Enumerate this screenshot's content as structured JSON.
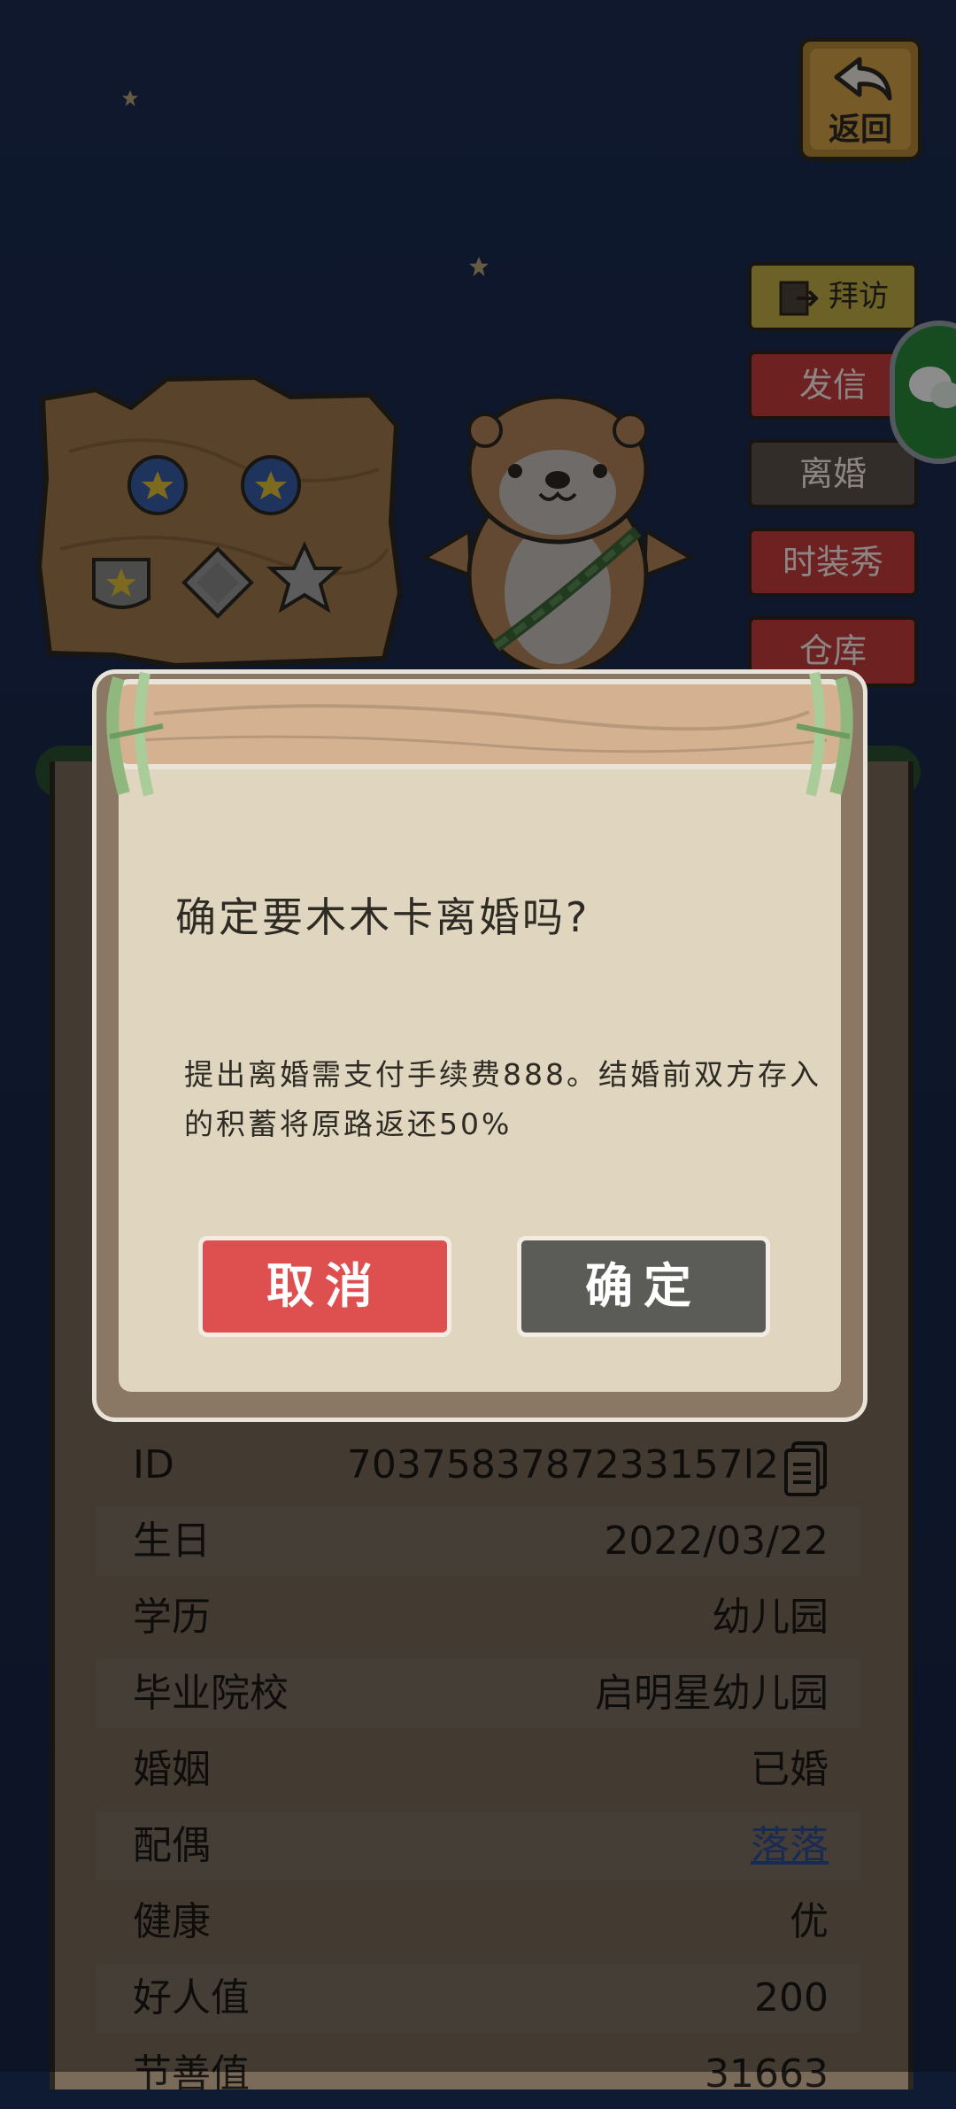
{
  "header": {
    "back_label": "返回"
  },
  "side_menu": {
    "visit": "拜访",
    "letter": "发信",
    "divorce": "离婚",
    "fashion": "时装秀",
    "warehouse": "仓库"
  },
  "profile": {
    "rows": [
      {
        "key": "ID",
        "value": "7037583787233157l2"
      },
      {
        "key": "生日",
        "value": "2022/03/22"
      },
      {
        "key": "学历",
        "value": "幼儿园"
      },
      {
        "key": "毕业院校",
        "value": "启明星幼儿园"
      },
      {
        "key": "婚姻",
        "value": "已婚"
      },
      {
        "key": "配偶",
        "value": "落落"
      },
      {
        "key": "健康",
        "value": "优"
      },
      {
        "key": "好人值",
        "value": "200"
      },
      {
        "key": "节善值",
        "value": "31663"
      }
    ]
  },
  "dialog": {
    "title": "确定要木木卡离婚吗?",
    "body": "提出离婚需支付手续费888。结婚前双方存入的积蓄将原路返还50%",
    "cancel_label": "取消",
    "confirm_label": "确定"
  },
  "colors": {
    "cancel": "#de4f4f",
    "confirm": "#5b5b57",
    "red_button": "#c93c3c",
    "visit_button": "#c5b24a",
    "link": "#2e4f96"
  }
}
